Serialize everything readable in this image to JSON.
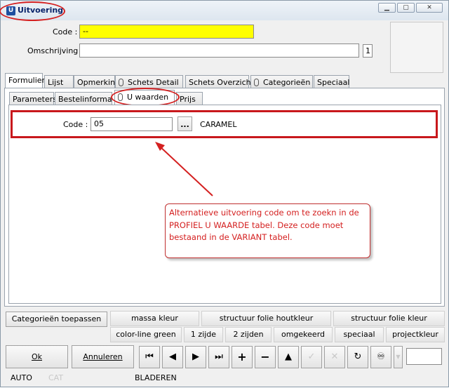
{
  "window": {
    "title": "Uitvoering",
    "icon": "app-icon",
    "controls": [
      "minimize",
      "maximize",
      "close"
    ]
  },
  "header": {
    "code_label": "Code :",
    "code_value": "--",
    "omschrijving_label": "Omschrijving :",
    "omschrijving_value": "",
    "count": "1"
  },
  "tabs": [
    {
      "label": "Formulier",
      "active": true
    },
    {
      "label": "Lijst"
    },
    {
      "label": "Opmerking"
    },
    {
      "label": "Schets Detail",
      "icon": "paperclip-icon"
    },
    {
      "label": "Schets Overzicht"
    },
    {
      "label": "Categorieën",
      "icon": "paperclip-icon"
    },
    {
      "label": "Speciaal"
    }
  ],
  "subtabs": [
    {
      "label": "Parameters"
    },
    {
      "label": "Bestelinformatie"
    },
    {
      "label": "U waarden",
      "icon": "paperclip-icon",
      "active": true
    },
    {
      "label": "Prijs"
    }
  ],
  "detail": {
    "code_label": "Code :",
    "code_value": "05",
    "lookup_button": "...",
    "result": "CARAMEL"
  },
  "callout": {
    "text": "Alternatieve uitvoering code om te zoekn in de PROFIEL U WAARDE tabel. Deze code moet bestaand in de VARIANT tabel."
  },
  "toolbar": {
    "apply_button": "Categorieën toepassen",
    "row1": [
      "massa kleur",
      "structuur folie houtkleur",
      "structuur folie kleur"
    ],
    "row2": [
      "color-line green",
      "1 zijde",
      "2 zijden",
      "omgekeerd",
      "speciaal",
      "projectkleur"
    ]
  },
  "footer": {
    "ok": "Ok",
    "cancel": "Annuleren"
  },
  "status": {
    "mode": "AUTO",
    "cat": "CAT",
    "state": "BLADEREN"
  },
  "colors": {
    "highlight": "#d42020",
    "code_field": "#ffff00",
    "callout_text": "#d42020"
  }
}
